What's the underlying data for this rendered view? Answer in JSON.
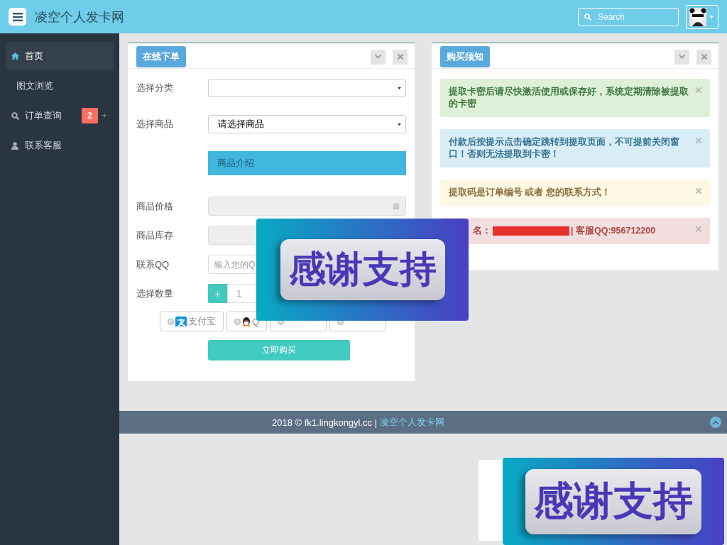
{
  "header": {
    "title": "凌空个人发卡网",
    "search": {
      "placeholder": "Search"
    }
  },
  "sidebar": {
    "items": [
      {
        "label": "首页",
        "selected": true
      },
      {
        "label": "图文浏览",
        "selected": false
      },
      {
        "label": "订单查询",
        "selected": false,
        "badge": "2",
        "extra": "+"
      },
      {
        "label": "联系客服",
        "selected": false
      }
    ]
  },
  "order_panel": {
    "title": "在线下单",
    "fields": [
      {
        "kind": "select",
        "label": "选择分类"
      },
      {
        "kind": "select",
        "label": "选择商品",
        "value": "请选择商品"
      },
      {
        "kind": "info",
        "text": "商品介绍"
      },
      {
        "kind": "readonly",
        "label": "商品价格"
      },
      {
        "kind": "readonly",
        "label": "商品库存"
      },
      {
        "kind": "input",
        "label": "联系QQ",
        "placeholder": "输入您的Q"
      },
      {
        "kind": "quantity",
        "label": "选择数量",
        "button": "+",
        "value": "1"
      }
    ],
    "payments": [
      {
        "kind": "option",
        "label": "支付宝"
      },
      {
        "kind": "option",
        "label": "Q"
      },
      {
        "kind": "option"
      },
      {
        "kind": "option"
      }
    ],
    "submit": "立即购买"
  },
  "notice_panel": {
    "title": "购买须知",
    "alerts": [
      {
        "kind": "success",
        "text": "提取卡密后请尽快激活使用或保存好，系统定期清除被提取的卡密"
      },
      {
        "kind": "info",
        "text": "付款后按提示点击确定跳转到提取页面，不可提前关闭窗口！否则无法提取到卡密！"
      },
      {
        "kind": "warning",
        "text": "提取码是订单编号 或者 您的联系方式！"
      },
      {
        "kind": "danger",
        "text": "名：",
        "redacted": true,
        "text_after": "| 客服QQ:956712200"
      }
    ]
  },
  "footer": {
    "text": "2018 © fk1.lingkongyl.cc |",
    "link": "凌空个人发卡网"
  },
  "banners": [
    {
      "text": "感谢支持"
    },
    {
      "text": "感谢支持"
    }
  ]
}
